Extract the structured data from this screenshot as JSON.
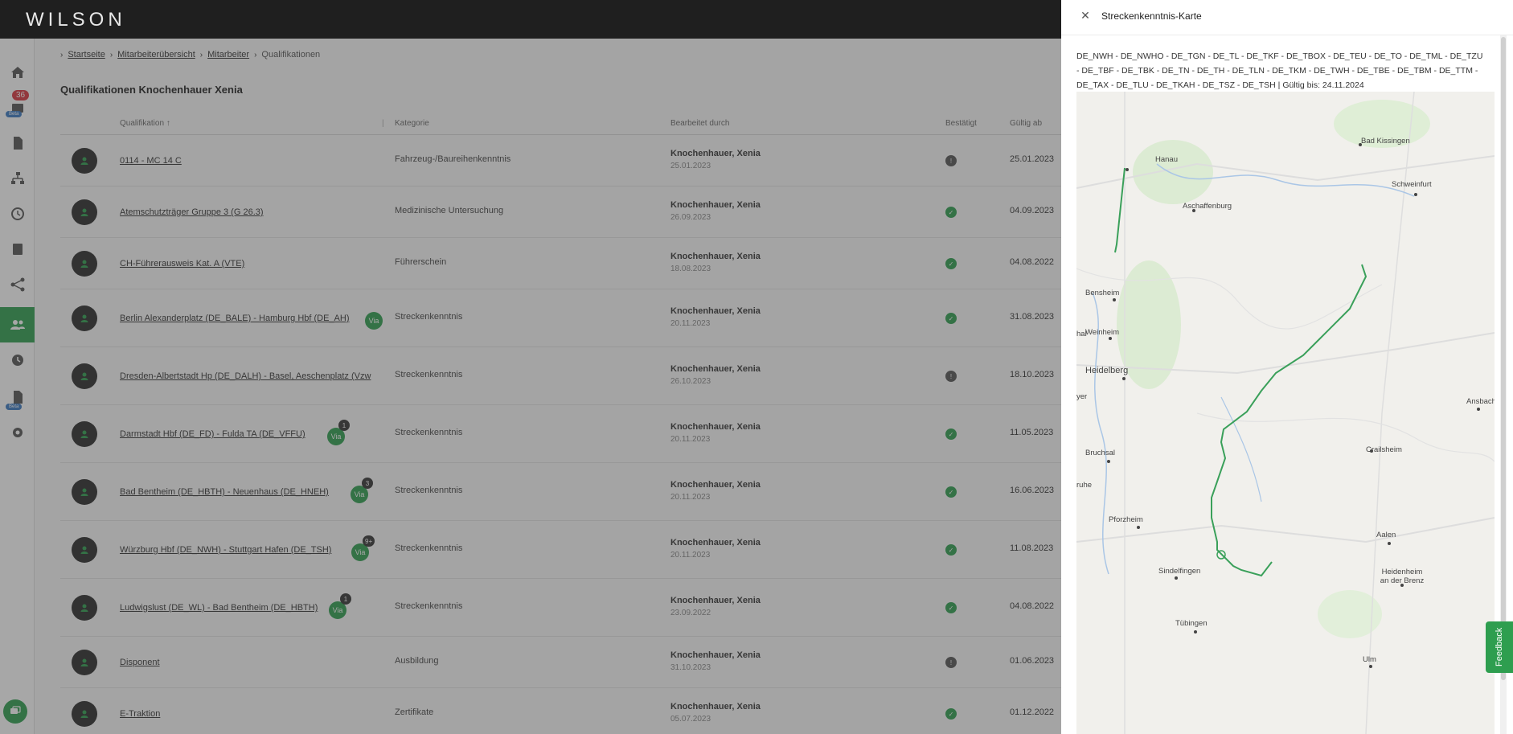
{
  "app": {
    "logo": "WILSON"
  },
  "sidebar": {
    "notification_count": "36",
    "beta_label": "Beta",
    "items": [
      {
        "icon": "home-icon"
      },
      {
        "icon": "inbox-icon"
      },
      {
        "icon": "document-icon"
      },
      {
        "icon": "org-chart-icon"
      },
      {
        "icon": "clock-icon"
      },
      {
        "icon": "book-icon"
      },
      {
        "icon": "network-icon"
      },
      {
        "icon": "users-icon"
      },
      {
        "icon": "history-icon"
      },
      {
        "icon": "report-icon"
      },
      {
        "icon": "gear-icon"
      }
    ]
  },
  "breadcrumb": [
    "Startseite",
    "Mitarbeiterübersicht",
    "Mitarbeiter",
    "Qualifikationen"
  ],
  "page_title": "Qualifikationen Knochenhauer Xenia",
  "table": {
    "headers": {
      "qualification": "Qualifikation",
      "category": "Kategorie",
      "edited_by": "Bearbeitet durch",
      "confirmed": "Bestätigt",
      "valid_from": "Gültig ab"
    },
    "rows": [
      {
        "name": "0114 - MC 14 C",
        "category": "Fahrzeug-/Baureihenkenntnis",
        "editor": "Knochenhauer, Xenia",
        "edit_date": "25.01.2023",
        "status": "warn",
        "valid_from": "25.01.2023",
        "via": "",
        "via_count": ""
      },
      {
        "name": "Atemschutzträger Gruppe 3 (G 26.3)",
        "category": "Medizinische Untersuchung",
        "editor": "Knochenhauer, Xenia",
        "edit_date": "26.09.2023",
        "status": "ok",
        "valid_from": "04.09.2023",
        "via": "",
        "via_count": ""
      },
      {
        "name": "CH-Führerausweis Kat. A (VTE)",
        "category": "Führerschein",
        "editor": "Knochenhauer, Xenia",
        "edit_date": "18.08.2023",
        "status": "ok",
        "valid_from": "04.08.2022",
        "via": "",
        "via_count": ""
      },
      {
        "name": "Berlin Alexanderplatz (DE_BALE) - Hamburg Hbf (DE_AH)",
        "category": "Streckenkenntnis",
        "editor": "Knochenhauer, Xenia",
        "edit_date": "20.11.2023",
        "status": "ok",
        "valid_from": "31.08.2023",
        "via": "Via",
        "via_count": ""
      },
      {
        "name": "Dresden-Albertstadt Hp (DE_DALH) - Basel, Aeschenplatz (Vzw",
        "category": "Streckenkenntnis",
        "editor": "Knochenhauer, Xenia",
        "edit_date": "26.10.2023",
        "status": "warn",
        "valid_from": "18.10.2023",
        "via": "",
        "via_count": ""
      },
      {
        "name": "Darmstadt Hbf (DE_FD) - Fulda TA (DE_VFFU)",
        "category": "Streckenkenntnis",
        "editor": "Knochenhauer, Xenia",
        "edit_date": "20.11.2023",
        "status": "ok",
        "valid_from": "11.05.2023",
        "via": "Via",
        "via_count": "1"
      },
      {
        "name": "Bad Bentheim (DE_HBTH) - Neuenhaus (DE_HNEH)",
        "category": "Streckenkenntnis",
        "editor": "Knochenhauer, Xenia",
        "edit_date": "20.11.2023",
        "status": "ok",
        "valid_from": "16.06.2023",
        "via": "Via",
        "via_count": "3"
      },
      {
        "name": "Würzburg Hbf (DE_NWH) - Stuttgart Hafen (DE_TSH)",
        "category": "Streckenkenntnis",
        "editor": "Knochenhauer, Xenia",
        "edit_date": "20.11.2023",
        "status": "ok",
        "valid_from": "11.08.2023",
        "via": "Via",
        "via_count": "9+"
      },
      {
        "name": "Ludwigslust (DE_WL) - Bad Bentheim (DE_HBTH)",
        "category": "Streckenkenntnis",
        "editor": "Knochenhauer, Xenia",
        "edit_date": "23.09.2022",
        "status": "ok",
        "valid_from": "04.08.2022",
        "via": "Via",
        "via_count": "1"
      },
      {
        "name": "Disponent",
        "category": "Ausbildung",
        "editor": "Knochenhauer, Xenia",
        "edit_date": "31.10.2023",
        "status": "warn",
        "valid_from": "01.06.2023",
        "via": "",
        "via_count": ""
      },
      {
        "name": "E-Traktion",
        "category": "Zertifikate",
        "editor": "Knochenhauer, Xenia",
        "edit_date": "05.07.2023",
        "status": "ok",
        "valid_from": "01.12.2022",
        "via": "",
        "via_count": ""
      }
    ]
  },
  "panel": {
    "title": "Streckenkenntnis-Karte",
    "routes_text": "DE_NWH - DE_NWHO - DE_TGN - DE_TL - DE_TKF - DE_TBOX - DE_TEU - DE_TO - DE_TML - DE_TZU - DE_TBF - DE_TBK - DE_TN - DE_TH - DE_TLN - DE_TKM - DE_TWH - DE_TBE - DE_TBM - DE_TTM - DE_TAX - DE_TLU - DE_TKAH - DE_TSZ - DE_TSH | Gültig bis: 24.11.2024",
    "map_cities": [
      "Bad Kissingen",
      "Hanau",
      "Schweinfurt",
      "Aschaffenburg",
      "Bensheim",
      "Weinheim",
      "Heidelberg",
      "Ansbach",
      "Crailsheim",
      "Bruchsal",
      "Pforzheim",
      "Aalen",
      "Sindelfingen",
      "Heidenheim an der Brenz",
      "Tübingen",
      "Ulm",
      "ruhe",
      "yer",
      "hal"
    ],
    "route_color": "#3aa05a",
    "feedback_label": "Feedback"
  }
}
